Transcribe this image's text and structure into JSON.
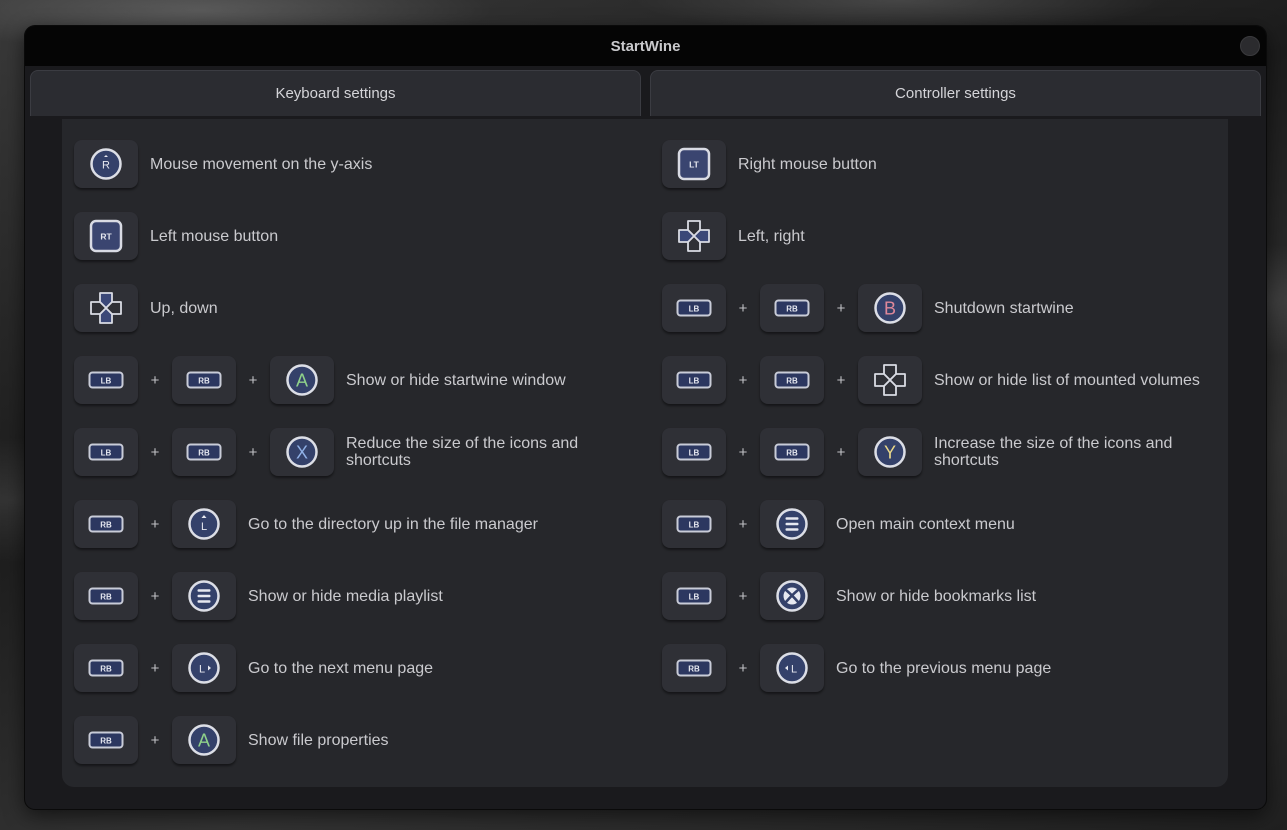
{
  "window": {
    "title": "StartWine"
  },
  "tabs": [
    {
      "label": "Keyboard settings"
    },
    {
      "label": "Controller settings"
    }
  ],
  "colors": {
    "a_green": "#8fd18a",
    "b_red": "#e0889a",
    "x_blue": "#8fb0e6",
    "y_yellow": "#e9d78a"
  },
  "left": [
    {
      "keys": [
        "stick-r-icon"
      ],
      "label": "Mouse movement on the y-axis"
    },
    {
      "keys": [
        "rt-trigger-icon"
      ],
      "label": "Left mouse button"
    },
    {
      "keys": [
        "dpad-up-down-icon"
      ],
      "label": "Up, down"
    },
    {
      "keys": [
        "lb-bumper-icon",
        "rb-bumper-icon",
        "a-button-icon"
      ],
      "label": "Show or hide startwine window"
    },
    {
      "keys": [
        "lb-bumper-icon",
        "rb-bumper-icon",
        "x-button-icon"
      ],
      "label": "Reduce the size of the icons and shortcuts"
    },
    {
      "keys": [
        "rb-bumper-icon",
        "stick-l-up-icon"
      ],
      "label": "Go to the directory up in the file manager"
    },
    {
      "keys": [
        "rb-bumper-icon",
        "menu-button-icon"
      ],
      "label": "Show or hide media playlist"
    },
    {
      "keys": [
        "rb-bumper-icon",
        "stick-l-right-icon"
      ],
      "label": "Go to the next menu page"
    },
    {
      "keys": [
        "rb-bumper-icon",
        "a-button-icon"
      ],
      "label": "Show file properties"
    }
  ],
  "right": [
    {
      "keys": [
        "lt-trigger-icon"
      ],
      "label": "Right mouse button"
    },
    {
      "keys": [
        "dpad-left-right-icon"
      ],
      "label": "Left, right"
    },
    {
      "keys": [
        "lb-bumper-icon",
        "rb-bumper-icon",
        "b-button-icon"
      ],
      "label": "Shutdown startwine"
    },
    {
      "keys": [
        "lb-bumper-icon",
        "rb-bumper-icon",
        "dpad-icon"
      ],
      "label": "Show or hide list of mounted volumes"
    },
    {
      "keys": [
        "lb-bumper-icon",
        "rb-bumper-icon",
        "y-button-icon"
      ],
      "label": "Increase the size of the icons and shortcuts"
    },
    {
      "keys": [
        "lb-bumper-icon",
        "menu-button-icon"
      ],
      "label": "Open main context menu"
    },
    {
      "keys": [
        "lb-bumper-icon",
        "xbox-button-icon"
      ],
      "label": "Show or hide bookmarks list"
    },
    {
      "keys": [
        "rb-bumper-icon",
        "stick-l-left-icon"
      ],
      "label": "Go to the previous menu page"
    }
  ],
  "key_text": {
    "lb": "LB",
    "rb": "RB",
    "lt": "LT",
    "rt": "RT",
    "a": "A",
    "b": "B",
    "x": "X",
    "y": "Y",
    "r": "R",
    "l": "L",
    "plus": "+"
  }
}
